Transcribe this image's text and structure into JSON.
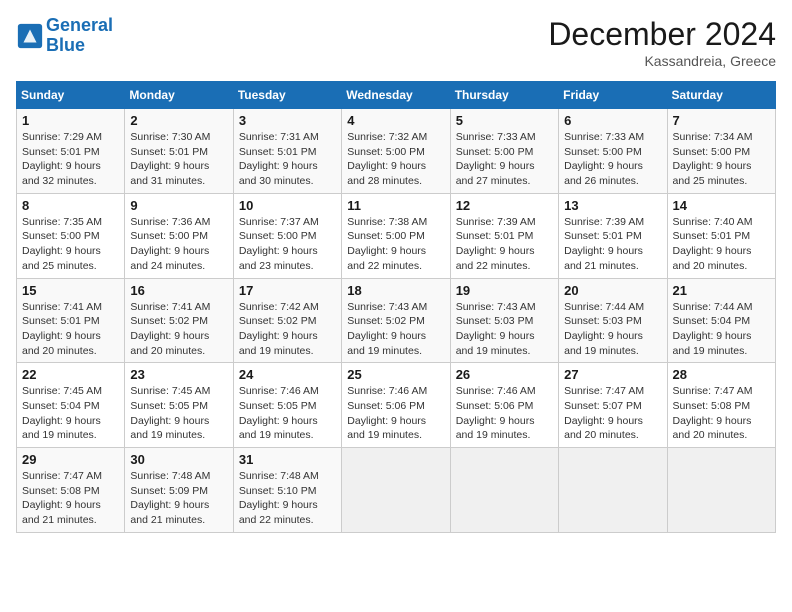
{
  "header": {
    "logo_line1": "General",
    "logo_line2": "Blue",
    "month": "December 2024",
    "location": "Kassandreia, Greece"
  },
  "weekdays": [
    "Sunday",
    "Monday",
    "Tuesday",
    "Wednesday",
    "Thursday",
    "Friday",
    "Saturday"
  ],
  "weeks": [
    [
      {
        "day": "1",
        "sunrise": "7:29 AM",
        "sunset": "5:01 PM",
        "daylight": "9 hours and 32 minutes."
      },
      {
        "day": "2",
        "sunrise": "7:30 AM",
        "sunset": "5:01 PM",
        "daylight": "9 hours and 31 minutes."
      },
      {
        "day": "3",
        "sunrise": "7:31 AM",
        "sunset": "5:01 PM",
        "daylight": "9 hours and 30 minutes."
      },
      {
        "day": "4",
        "sunrise": "7:32 AM",
        "sunset": "5:00 PM",
        "daylight": "9 hours and 28 minutes."
      },
      {
        "day": "5",
        "sunrise": "7:33 AM",
        "sunset": "5:00 PM",
        "daylight": "9 hours and 27 minutes."
      },
      {
        "day": "6",
        "sunrise": "7:33 AM",
        "sunset": "5:00 PM",
        "daylight": "9 hours and 26 minutes."
      },
      {
        "day": "7",
        "sunrise": "7:34 AM",
        "sunset": "5:00 PM",
        "daylight": "9 hours and 25 minutes."
      }
    ],
    [
      {
        "day": "8",
        "sunrise": "7:35 AM",
        "sunset": "5:00 PM",
        "daylight": "9 hours and 25 minutes."
      },
      {
        "day": "9",
        "sunrise": "7:36 AM",
        "sunset": "5:00 PM",
        "daylight": "9 hours and 24 minutes."
      },
      {
        "day": "10",
        "sunrise": "7:37 AM",
        "sunset": "5:00 PM",
        "daylight": "9 hours and 23 minutes."
      },
      {
        "day": "11",
        "sunrise": "7:38 AM",
        "sunset": "5:00 PM",
        "daylight": "9 hours and 22 minutes."
      },
      {
        "day": "12",
        "sunrise": "7:39 AM",
        "sunset": "5:01 PM",
        "daylight": "9 hours and 22 minutes."
      },
      {
        "day": "13",
        "sunrise": "7:39 AM",
        "sunset": "5:01 PM",
        "daylight": "9 hours and 21 minutes."
      },
      {
        "day": "14",
        "sunrise": "7:40 AM",
        "sunset": "5:01 PM",
        "daylight": "9 hours and 20 minutes."
      }
    ],
    [
      {
        "day": "15",
        "sunrise": "7:41 AM",
        "sunset": "5:01 PM",
        "daylight": "9 hours and 20 minutes."
      },
      {
        "day": "16",
        "sunrise": "7:41 AM",
        "sunset": "5:02 PM",
        "daylight": "9 hours and 20 minutes."
      },
      {
        "day": "17",
        "sunrise": "7:42 AM",
        "sunset": "5:02 PM",
        "daylight": "9 hours and 19 minutes."
      },
      {
        "day": "18",
        "sunrise": "7:43 AM",
        "sunset": "5:02 PM",
        "daylight": "9 hours and 19 minutes."
      },
      {
        "day": "19",
        "sunrise": "7:43 AM",
        "sunset": "5:03 PM",
        "daylight": "9 hours and 19 minutes."
      },
      {
        "day": "20",
        "sunrise": "7:44 AM",
        "sunset": "5:03 PM",
        "daylight": "9 hours and 19 minutes."
      },
      {
        "day": "21",
        "sunrise": "7:44 AM",
        "sunset": "5:04 PM",
        "daylight": "9 hours and 19 minutes."
      }
    ],
    [
      {
        "day": "22",
        "sunrise": "7:45 AM",
        "sunset": "5:04 PM",
        "daylight": "9 hours and 19 minutes."
      },
      {
        "day": "23",
        "sunrise": "7:45 AM",
        "sunset": "5:05 PM",
        "daylight": "9 hours and 19 minutes."
      },
      {
        "day": "24",
        "sunrise": "7:46 AM",
        "sunset": "5:05 PM",
        "daylight": "9 hours and 19 minutes."
      },
      {
        "day": "25",
        "sunrise": "7:46 AM",
        "sunset": "5:06 PM",
        "daylight": "9 hours and 19 minutes."
      },
      {
        "day": "26",
        "sunrise": "7:46 AM",
        "sunset": "5:06 PM",
        "daylight": "9 hours and 19 minutes."
      },
      {
        "day": "27",
        "sunrise": "7:47 AM",
        "sunset": "5:07 PM",
        "daylight": "9 hours and 20 minutes."
      },
      {
        "day": "28",
        "sunrise": "7:47 AM",
        "sunset": "5:08 PM",
        "daylight": "9 hours and 20 minutes."
      }
    ],
    [
      {
        "day": "29",
        "sunrise": "7:47 AM",
        "sunset": "5:08 PM",
        "daylight": "9 hours and 21 minutes."
      },
      {
        "day": "30",
        "sunrise": "7:48 AM",
        "sunset": "5:09 PM",
        "daylight": "9 hours and 21 minutes."
      },
      {
        "day": "31",
        "sunrise": "7:48 AM",
        "sunset": "5:10 PM",
        "daylight": "9 hours and 22 minutes."
      },
      null,
      null,
      null,
      null
    ]
  ],
  "labels": {
    "sunrise": "Sunrise:",
    "sunset": "Sunset:",
    "daylight": "Daylight:"
  }
}
